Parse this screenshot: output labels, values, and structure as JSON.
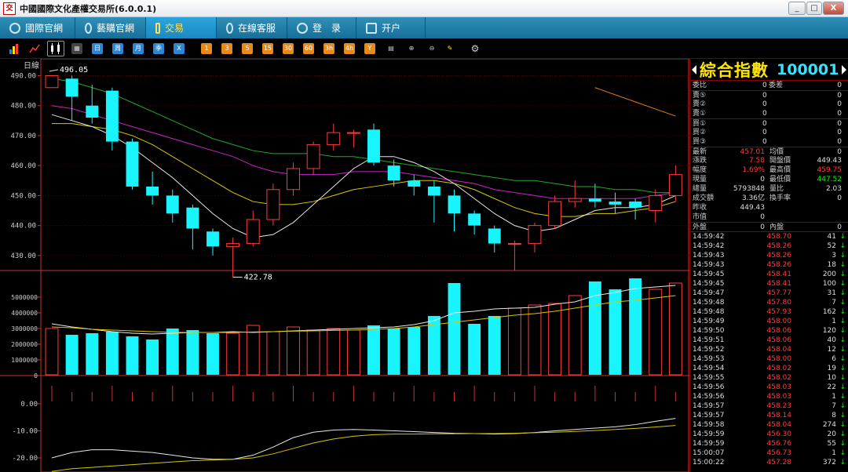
{
  "window": {
    "title": "中國國際文化產權交易所(6.0.0.1)",
    "logo": "交",
    "min": "_",
    "max": "□",
    "close": "X"
  },
  "menu": [
    {
      "label": "國際官網",
      "active": false,
      "icon": "globe-icon"
    },
    {
      "label": "藝購官網",
      "active": false,
      "icon": "link-icon"
    },
    {
      "label": "交易",
      "active": true,
      "icon": "trade-icon"
    },
    {
      "label": "在線客服",
      "active": false,
      "icon": "chat-icon"
    },
    {
      "label": "登　录",
      "active": false,
      "icon": "login-icon"
    },
    {
      "label": "开户",
      "active": false,
      "icon": "account-icon"
    }
  ],
  "toolbar": {
    "periods": [
      "日",
      "周",
      "月",
      "季",
      "X"
    ],
    "minutes": [
      "1",
      "3",
      "5",
      "15",
      "30",
      "60",
      "3h",
      "4h",
      "Y"
    ]
  },
  "chart_data": {
    "type": "candlestick",
    "title": "日線",
    "price_ticks": [
      "490.00",
      "480.00",
      "470.00",
      "460.00",
      "450.00",
      "440.00",
      "430.00"
    ],
    "volume_ticks": [
      "5000000",
      "4000000",
      "3000000",
      "2000000",
      "1000000",
      "0"
    ],
    "indicator_ticks": [
      "0.00",
      "-10.00",
      "-20.00"
    ],
    "high_label": "496.05",
    "low_label": "422.78",
    "price_range": [
      425,
      493
    ],
    "candles": [
      {
        "o": 486,
        "c": 490,
        "h": 490,
        "l": 486,
        "up": true
      },
      {
        "o": 489,
        "c": 483,
        "h": 490,
        "l": 475,
        "up": false
      },
      {
        "o": 480,
        "c": 476,
        "h": 487,
        "l": 474,
        "up": false
      },
      {
        "o": 485,
        "c": 468,
        "h": 486,
        "l": 465,
        "up": false
      },
      {
        "o": 468,
        "c": 453,
        "h": 469,
        "l": 452,
        "up": false
      },
      {
        "o": 453,
        "c": 450,
        "h": 458,
        "l": 447,
        "up": false
      },
      {
        "o": 450,
        "c": 444,
        "h": 452,
        "l": 441,
        "up": false
      },
      {
        "o": 446,
        "c": 439,
        "h": 447,
        "l": 432,
        "up": false
      },
      {
        "o": 438,
        "c": 433,
        "h": 439,
        "l": 430,
        "up": false
      },
      {
        "o": 434,
        "c": 433,
        "h": 436,
        "l": 422.78,
        "up": true
      },
      {
        "o": 434,
        "c": 442,
        "h": 445,
        "l": 433,
        "up": true
      },
      {
        "o": 442,
        "c": 452,
        "h": 454,
        "l": 440,
        "up": true
      },
      {
        "o": 452,
        "c": 459,
        "h": 461,
        "l": 450,
        "up": true
      },
      {
        "o": 459,
        "c": 467,
        "h": 468,
        "l": 457,
        "up": true
      },
      {
        "o": 467,
        "c": 471,
        "h": 474,
        "l": 465,
        "up": true
      },
      {
        "o": 471,
        "c": 471,
        "h": 472,
        "l": 466,
        "up": true
      },
      {
        "o": 472,
        "c": 461,
        "h": 474,
        "l": 460,
        "up": false
      },
      {
        "o": 460,
        "c": 455,
        "h": 462,
        "l": 453,
        "up": false
      },
      {
        "o": 455,
        "c": 453,
        "h": 457,
        "l": 450,
        "up": false
      },
      {
        "o": 453,
        "c": 450,
        "h": 455,
        "l": 441,
        "up": false
      },
      {
        "o": 450,
        "c": 444,
        "h": 452,
        "l": 438,
        "up": false
      },
      {
        "o": 444,
        "c": 440,
        "h": 445,
        "l": 437,
        "up": false
      },
      {
        "o": 439,
        "c": 434,
        "h": 440,
        "l": 431,
        "up": false
      },
      {
        "o": 434,
        "c": 434,
        "h": 435,
        "l": 425,
        "up": true
      },
      {
        "o": 434,
        "c": 440,
        "h": 441,
        "l": 431,
        "up": true
      },
      {
        "o": 440,
        "c": 448,
        "h": 450,
        "l": 439,
        "up": true
      },
      {
        "o": 448,
        "c": 449,
        "h": 455,
        "l": 446,
        "up": true
      },
      {
        "o": 449,
        "c": 448,
        "h": 454,
        "l": 446,
        "up": false
      },
      {
        "o": 448,
        "c": 447,
        "h": 451,
        "l": 444,
        "up": false
      },
      {
        "o": 448,
        "c": 446,
        "h": 449,
        "l": 442,
        "up": false
      },
      {
        "o": 445,
        "c": 450,
        "h": 452,
        "l": 441,
        "up": true
      },
      {
        "o": 450,
        "c": 457,
        "h": 460,
        "l": 448,
        "up": true
      }
    ],
    "ma5": [
      477,
      475,
      473,
      470,
      466,
      461,
      456,
      450,
      444,
      439,
      436,
      437,
      441,
      447,
      453,
      459,
      463,
      463,
      461,
      458,
      454,
      449,
      444,
      440,
      438,
      439,
      442,
      445,
      446,
      446,
      447,
      450
    ],
    "ma10": [
      474,
      474,
      473,
      472,
      470,
      467,
      463,
      459,
      455,
      451,
      448,
      447,
      447,
      448,
      450,
      452,
      453,
      454,
      455,
      455,
      454,
      452,
      449,
      446,
      444,
      443,
      443,
      444,
      444,
      445,
      446,
      448
    ],
    "ma20": [
      480,
      479,
      477,
      475,
      473,
      471,
      469,
      467,
      465,
      463,
      460,
      458,
      457,
      457,
      457,
      458,
      458,
      458,
      457,
      456,
      455,
      454,
      452,
      451,
      450,
      449,
      449,
      449,
      449,
      449,
      450,
      451
    ],
    "ma60": [
      489,
      488,
      486,
      484,
      481,
      478,
      475,
      472,
      469,
      467,
      465,
      464,
      464,
      464,
      463,
      463,
      462,
      461,
      460,
      459,
      458,
      457,
      456,
      455,
      455,
      454,
      453,
      453,
      452,
      452,
      451,
      451
    ],
    "orange_line": [
      [
        27,
        486
      ],
      [
        31,
        476.5
      ]
    ],
    "volumes": [
      3000000,
      2600000,
      2700000,
      2800000,
      2500000,
      2300000,
      3000000,
      2900000,
      2700000,
      2700000,
      3200000,
      2800000,
      3100000,
      2900000,
      3000000,
      2900000,
      3200000,
      3000000,
      3100000,
      3800000,
      5900000,
      3300000,
      3800000,
      4300000,
      4500000,
      4600000,
      5100000,
      6000000,
      5500000,
      6200000,
      5500000,
      5900000
    ],
    "vol_ma1": [
      3300000,
      3100000,
      2950000,
      2800000,
      2700000,
      2650000,
      2700000,
      2750000,
      2750000,
      2800000,
      2750000,
      2800000,
      2850000,
      2900000,
      2950000,
      3000000,
      3050000,
      3100000,
      3250000,
      3500000,
      4000000,
      4100000,
      4250000,
      4300000,
      4350000,
      4550000,
      4700000,
      5100000,
      5300000,
      5550000,
      5650000,
      5750000
    ],
    "vol_ma2": [
      3100000,
      3050000,
      2950000,
      2900000,
      2850000,
      2800000,
      2750000,
      2750000,
      2750000,
      2750000,
      2780000,
      2800000,
      2830000,
      2850000,
      2880000,
      2900000,
      2950000,
      3000000,
      3100000,
      3250000,
      3400000,
      3550000,
      3700000,
      3850000,
      3950000,
      4100000,
      4300000,
      4500000,
      4700000,
      4800000,
      4950000,
      5100000
    ],
    "ind1": [
      -20,
      -18,
      -17,
      -17,
      -17.5,
      -18,
      -19,
      -20,
      -20.5,
      -20.5,
      -19,
      -16,
      -12.5,
      -10.5,
      -9.7,
      -9.5,
      -9.7,
      -10,
      -10.3,
      -10.6,
      -10.9,
      -11,
      -11.2,
      -11,
      -10.6,
      -10,
      -9.5,
      -9,
      -8.5,
      -7.7,
      -6.5,
      -5.4
    ],
    "ind2": [
      -25,
      -24,
      -23.5,
      -23,
      -22.5,
      -22,
      -21.5,
      -21,
      -20.8,
      -20.5,
      -20,
      -18.5,
      -16.5,
      -14.5,
      -13,
      -12,
      -11.4,
      -11.2,
      -11.2,
      -11.1,
      -11.1,
      -11,
      -11,
      -10.9,
      -10.7,
      -10.5,
      -10.2,
      -9.9,
      -9.5,
      -9.1,
      -8.6,
      -8
    ]
  },
  "quote": {
    "name": "綜合指數",
    "code": "100001",
    "order_book": [
      {
        "label": "委比",
        "value": "0",
        "label2": "委差",
        "value2": "0"
      },
      {
        "label": "賣⑤",
        "value": "0",
        "right": "0"
      },
      {
        "label": "賣②",
        "value": "0",
        "right": "0"
      },
      {
        "label": "賣①",
        "value": "0",
        "right": "0"
      },
      {
        "label": "買①",
        "value": "0",
        "right": "0"
      },
      {
        "label": "買②",
        "value": "0",
        "right": "0"
      },
      {
        "label": "買③",
        "value": "0",
        "right": "0"
      }
    ],
    "stats": [
      {
        "l1": "最新",
        "v1": "457.01",
        "c1": "red",
        "l2": "均價",
        "v2": "0",
        "c2": "white"
      },
      {
        "l1": "漲跌",
        "v1": "7.58",
        "c1": "red",
        "l2": "開盤價",
        "v2": "449.43",
        "c2": "white"
      },
      {
        "l1": "幅度",
        "v1": "1.69%",
        "c1": "red",
        "l2": "最高價",
        "v2": "459.75",
        "c2": "red"
      },
      {
        "l1": "現量",
        "v1": "0",
        "c1": "white",
        "l2": "最低價",
        "v2": "447.52",
        "c2": "green"
      },
      {
        "l1": "總量",
        "v1": "5793848",
        "c1": "white",
        "l2": "量比",
        "v2": "2.03",
        "c2": "white"
      },
      {
        "l1": "成交額",
        "v1": "3.36亿",
        "c1": "white",
        "l2": "換手率",
        "v2": "0",
        "c2": "white"
      },
      {
        "l1": "昨收",
        "v1": "449.43",
        "c1": "white",
        "l2": "",
        "v2": "",
        "c2": "white"
      },
      {
        "l1": "市值",
        "v1": "0",
        "c1": "white",
        "l2": "",
        "v2": "",
        "c2": "white"
      },
      {
        "l1": "外盤",
        "v1": "0",
        "c1": "white",
        "l2": "內盤",
        "v2": "0",
        "c2": "white"
      }
    ],
    "ticks": [
      {
        "t": "14:59:42",
        "p": "458.70",
        "v": "41"
      },
      {
        "t": "14:59:42",
        "p": "458.26",
        "v": "52"
      },
      {
        "t": "14:59:43",
        "p": "458.26",
        "v": "3"
      },
      {
        "t": "14:59:43",
        "p": "458.26",
        "v": "18"
      },
      {
        "t": "14:59:45",
        "p": "458.41",
        "v": "200"
      },
      {
        "t": "14:59:45",
        "p": "458.41",
        "v": "100"
      },
      {
        "t": "14:59:47",
        "p": "457.77",
        "v": "31"
      },
      {
        "t": "14:59:48",
        "p": "457.80",
        "v": "7"
      },
      {
        "t": "14:59:48",
        "p": "457.93",
        "v": "162"
      },
      {
        "t": "14:59:49",
        "p": "458.00",
        "v": "1"
      },
      {
        "t": "14:59:50",
        "p": "458.06",
        "v": "120"
      },
      {
        "t": "14:59:51",
        "p": "458.06",
        "v": "40"
      },
      {
        "t": "14:59:52",
        "p": "458.04",
        "v": "12"
      },
      {
        "t": "14:59:53",
        "p": "458.00",
        "v": "6"
      },
      {
        "t": "14:59:54",
        "p": "458.02",
        "v": "19"
      },
      {
        "t": "14:59:55",
        "p": "458.02",
        "v": "10"
      },
      {
        "t": "14:59:56",
        "p": "458.03",
        "v": "22"
      },
      {
        "t": "14:59:56",
        "p": "458.03",
        "v": "1"
      },
      {
        "t": "14:59:57",
        "p": "458.23",
        "v": "7"
      },
      {
        "t": "14:59:57",
        "p": "458.14",
        "v": "8"
      },
      {
        "t": "14:59:58",
        "p": "458.04",
        "v": "274"
      },
      {
        "t": "14:59:59",
        "p": "456.30",
        "v": "20"
      },
      {
        "t": "14:59:59",
        "p": "456.76",
        "v": "55"
      },
      {
        "t": "15:00:07",
        "p": "456.73",
        "v": "1"
      },
      {
        "t": "15:00:22",
        "p": "457.28",
        "v": "372"
      }
    ],
    "colors": {
      "up": "#ff3b3b",
      "down": "#00ff00",
      "label": "#cccccc"
    }
  }
}
